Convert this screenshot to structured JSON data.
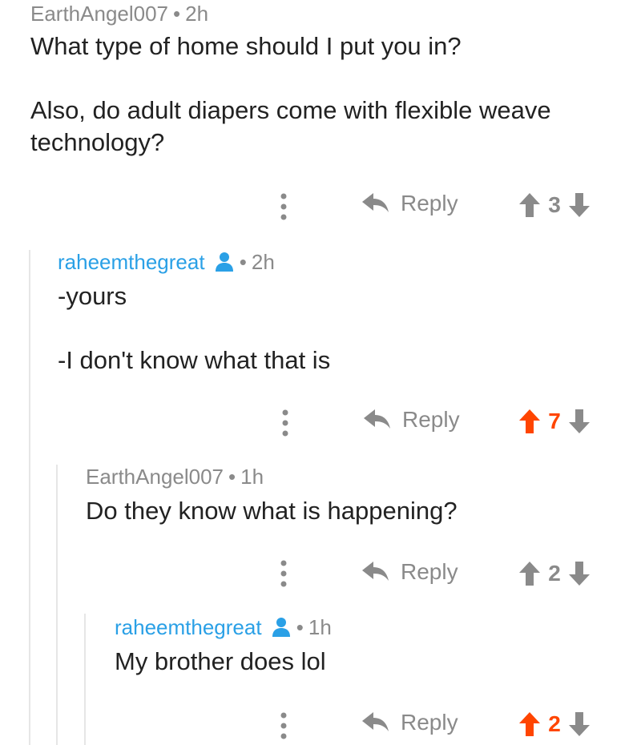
{
  "colors": {
    "meta_gray": "#8a8a8a",
    "mod_blue": "#2aa0e6",
    "upvoted_orange": "#ff4500",
    "neutral_gray": "#8a8a8a"
  },
  "comments": [
    {
      "username": "EarthAngel007",
      "time": "2h",
      "is_op_style": true,
      "paragraphs": [
        "What type of home should I put you in?",
        "Also, do adult diapers come with flexible weave technology?"
      ],
      "reply_label": "Reply",
      "score": "3",
      "upvoted": false
    },
    {
      "username": "raheemthegreat",
      "time": "2h",
      "has_user_icon": true,
      "paragraphs": [
        "-yours",
        "-I don't know what that is"
      ],
      "reply_label": "Reply",
      "score": "7",
      "upvoted": true
    },
    {
      "username": "EarthAngel007",
      "time": "1h",
      "paragraphs": [
        "Do they know what is happening?"
      ],
      "reply_label": "Reply",
      "score": "2",
      "upvoted": false
    },
    {
      "username": "raheemthegreat",
      "time": "1h",
      "has_user_icon": true,
      "paragraphs": [
        "My brother does lol"
      ],
      "reply_label": "Reply",
      "score": "2",
      "upvoted": true
    }
  ],
  "icons": {
    "more": "kebab-icon",
    "reply": "reply-arrow-icon",
    "up": "upvote-arrow-icon",
    "down": "downvote-arrow-icon",
    "user": "user-icon"
  }
}
